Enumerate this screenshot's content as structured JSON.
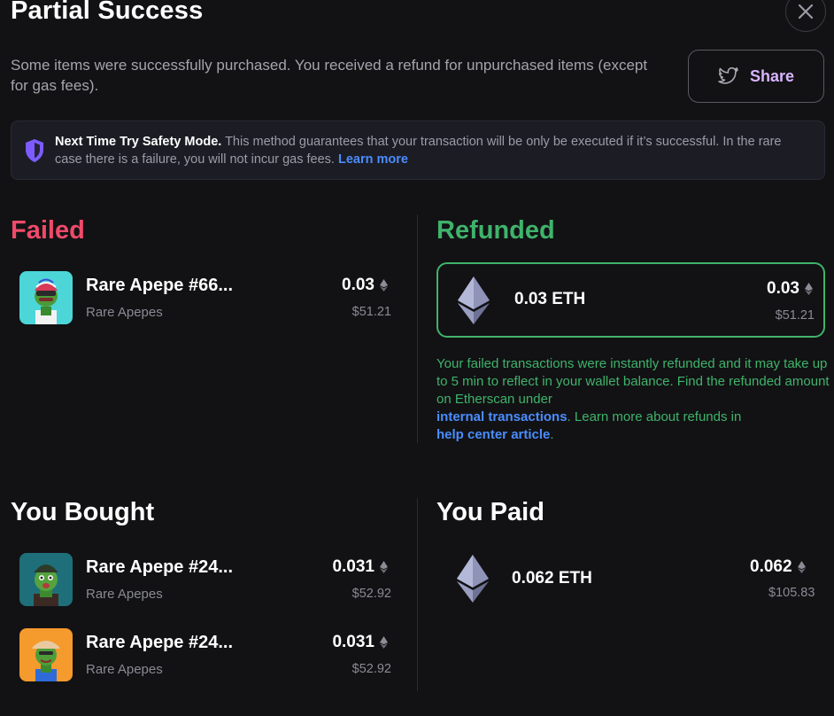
{
  "header": {
    "title": "Partial Success",
    "subtitle": "Some items were successfully purchased. You received a refund for unpurchased items (except for gas fees).",
    "share_label": "Share"
  },
  "safety": {
    "title": "Next Time Try Safety Mode.",
    "body": "This method guarantees that your transaction will be only be executed if it’s successful. In the rare case there is a failure, you will not incur gas fees.",
    "link": "Learn more"
  },
  "failed": {
    "title": "Failed",
    "items": [
      {
        "name": "Rare Apepe #66...",
        "collection": "Rare Apepes",
        "price": "0.03",
        "usd": "$51.21"
      }
    ]
  },
  "refunded": {
    "title": "Refunded",
    "amount_label": "0.03 ETH",
    "price": "0.03",
    "usd": "$51.21",
    "note_part1": "Your failed transactions were instantly refunded and it may take up to 5 min to reflect in your wallet balance. Find the refunded amount on Etherscan under",
    "note_link1": "internal transactions",
    "note_part2": ". Learn more about refunds in",
    "note_link2": "help center article",
    "note_part3": "."
  },
  "bought": {
    "title": "You Bought",
    "items": [
      {
        "name": "Rare Apepe #24...",
        "collection": "Rare Apepes",
        "price": "0.031",
        "usd": "$52.92"
      },
      {
        "name": "Rare Apepe #24...",
        "collection": "Rare Apepes",
        "price": "0.031",
        "usd": "$52.92"
      }
    ]
  },
  "paid": {
    "title": "You Paid",
    "amount_label": "0.062 ETH",
    "price": "0.062",
    "usd": "$105.83"
  },
  "icons": {
    "close": "close-icon",
    "share": "twitter-bird-icon",
    "shield": "shield-icon",
    "eth": "ethereum-icon"
  },
  "colors": {
    "failed": "#ef4a6a",
    "refunded": "#3fb36b",
    "link": "#4a8dff",
    "share_gradient": "#d7b4ff",
    "shield": "#7c5cff"
  }
}
